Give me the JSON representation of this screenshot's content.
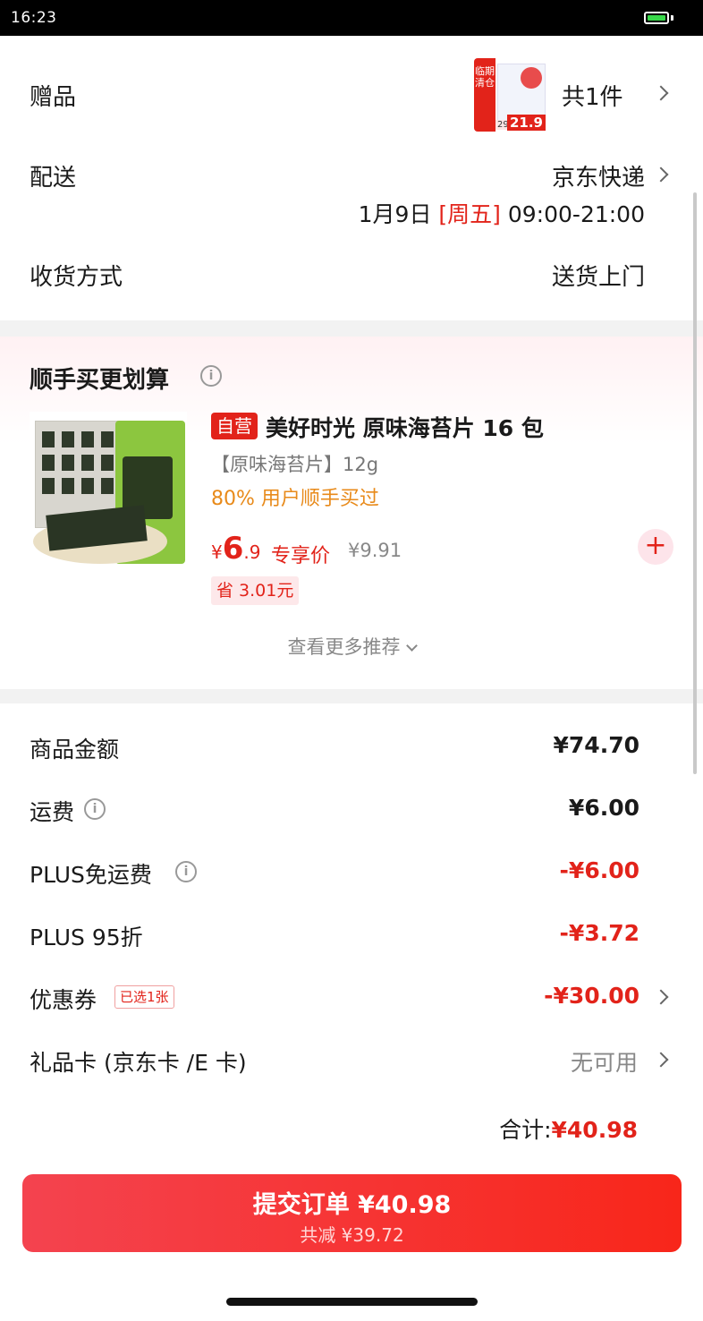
{
  "status_bar": {
    "time": "16:23"
  },
  "gift": {
    "label": "赠品",
    "count": "共1件",
    "thumb": {
      "tag": "临期清仓",
      "price_a": "29.9",
      "price_b": "21.9"
    }
  },
  "delivery": {
    "label": "配送",
    "method": "京东快递",
    "date": "1月9日",
    "weekday": "[周五]",
    "time_range": "09:00-21:00"
  },
  "receive": {
    "label": "收货方式",
    "value": "送货上门"
  },
  "recommend": {
    "title": "顺手买更划算",
    "item": {
      "badge": "自营",
      "name": "美好时光 原味海苔片 16 包",
      "spec": "【原味海苔片】12g",
      "bought": "80% 用户顺手买过",
      "currency": "¥",
      "price_int": "6",
      "price_dec": ".9",
      "price_tag": "专享价",
      "orig_price": "¥9.91",
      "save": "省 3.01元",
      "add_symbol": "+"
    },
    "more": "查看更多推荐"
  },
  "price_rows": {
    "goods": {
      "label": "商品金额",
      "value": "¥74.70"
    },
    "shipping": {
      "label": "运费",
      "value": "¥6.00"
    },
    "plus_free": {
      "label": "PLUS免运费",
      "value": "-¥6.00"
    },
    "plus_discount": {
      "label": "PLUS 95折",
      "value": "-¥3.72"
    },
    "coupon": {
      "label": "优惠券",
      "badge": "已选1张",
      "value": "-¥30.00"
    },
    "giftcard": {
      "label": "礼品卡 (京东卡 /E 卡)",
      "value": "无可用"
    }
  },
  "total": {
    "label": "合计:",
    "amount": "¥40.98"
  },
  "submit": {
    "label": "提交订单 ¥40.98",
    "sub": "共减 ¥39.72"
  },
  "colors": {
    "accent": "#e2231a",
    "orange": "#e88a1a"
  }
}
